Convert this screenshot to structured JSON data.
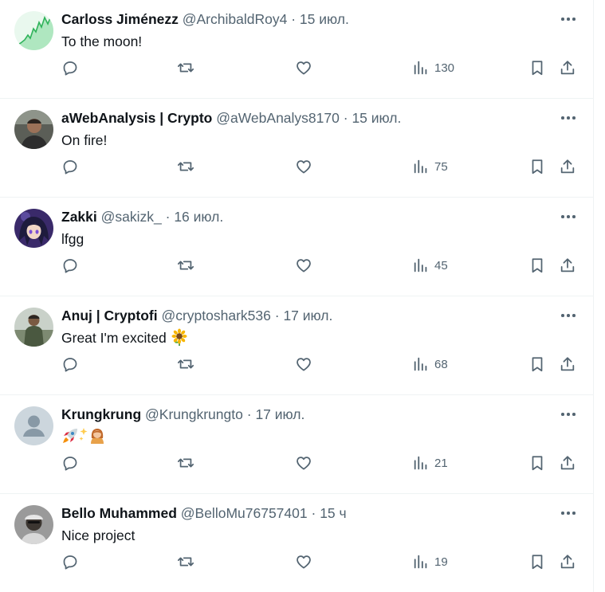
{
  "posts": [
    {
      "name": "Carloss Jiménezz",
      "handle": "@ArchibaldRoy4",
      "sep": "·",
      "time": "15 июл.",
      "text": "To the moon!",
      "views": "130"
    },
    {
      "name": "aWebAnalysis | Crypto",
      "handle": "@aWebAnalys8170",
      "sep": "·",
      "time": "15 июл.",
      "text": "On fire!",
      "views": "75"
    },
    {
      "name": "Zakki",
      "handle": "@sakizk_",
      "sep": "·",
      "time": "16 июл.",
      "text": "lfgg",
      "views": "45"
    },
    {
      "name": "Anuj | Cryptofi",
      "handle": "@cryptoshark536",
      "sep": "·",
      "time": "17 июл.",
      "text": "Great I'm excited",
      "views": "68"
    },
    {
      "name": "Krungkrung",
      "handle": "@Krungkrungto",
      "sep": "·",
      "time": "17 июл.",
      "text": "",
      "views": "21"
    },
    {
      "name": "Bello Muhammed",
      "handle": "@BelloMu76757401",
      "sep": "·",
      "time": "15 ч",
      "text": "Nice project",
      "views": "19"
    }
  ],
  "emoji": {
    "post4": [
      "sunflower-emoji"
    ],
    "post5": [
      "rocket-emoji",
      "sparkles-emoji",
      "woman-emoji"
    ]
  },
  "colors": {
    "text_primary": "#0f1419",
    "text_secondary": "#536471",
    "divider": "#eff3f4"
  }
}
